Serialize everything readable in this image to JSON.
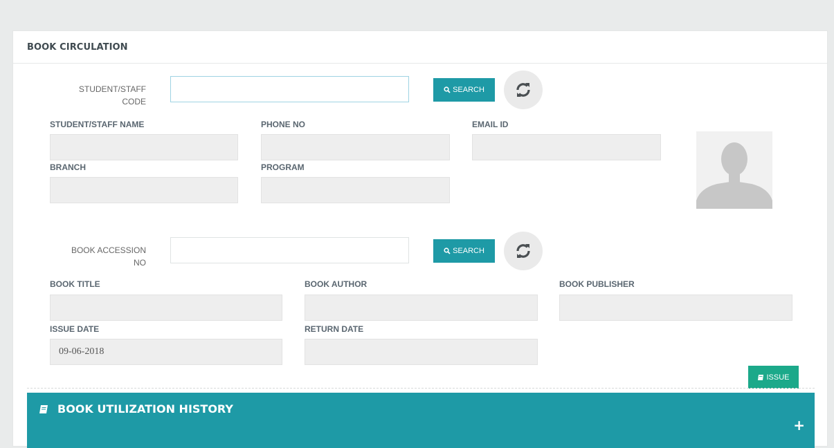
{
  "panel": {
    "title": "BOOK CIRCULATION"
  },
  "student_search": {
    "label_line1": "STUDENT/STAFF",
    "label_line2": "CODE",
    "value": "",
    "search_label": "SEARCH",
    "refresh_icon": "refresh-icon"
  },
  "student_fields": {
    "name_label": "STUDENT/STAFF NAME",
    "name_value": "",
    "phone_label": "PHONE NO",
    "phone_value": "",
    "email_label": "EMAIL ID",
    "email_value": "",
    "branch_label": "BRANCH",
    "branch_value": "",
    "program_label": "PROGRAM",
    "program_value": "",
    "avatar_icon": "user-silhouette"
  },
  "book_search": {
    "label_line1": "BOOK ACCESSION",
    "label_line2": "NO",
    "value": "",
    "search_label": "SEARCH",
    "refresh_icon": "refresh-icon"
  },
  "book_fields": {
    "title_label": "BOOK TITLE",
    "title_value": "",
    "author_label": "BOOK AUTHOR",
    "author_value": "",
    "publisher_label": "BOOK PUBLISHER",
    "publisher_value": "",
    "issue_date_label": "ISSUE DATE",
    "issue_date_value": "09-06-2018",
    "return_date_label": "RETURN DATE",
    "return_date_value": ""
  },
  "actions": {
    "issue_label": "ISSUE"
  },
  "history": {
    "title": "BOOK UTILIZATION HISTORY",
    "expand_icon": "plus-icon"
  },
  "colors": {
    "teal": "#1e9aa6",
    "green": "#1ca98a",
    "field_bg": "#eeeeee"
  }
}
